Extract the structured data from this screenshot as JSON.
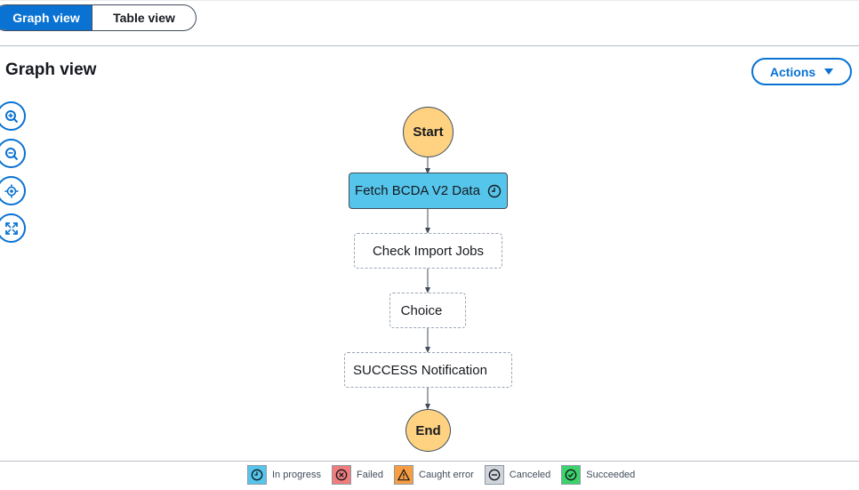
{
  "tabs": {
    "graph_view": "Graph view",
    "table_view": "Table view"
  },
  "header": {
    "title": "Graph view",
    "actions_label": "Actions"
  },
  "zoom_controls": [
    "zoom-in-icon",
    "zoom-out-icon",
    "center-icon",
    "fit-icon"
  ],
  "graph": {
    "start": "Start",
    "states": [
      {
        "label": "Fetch BCDA V2 Data",
        "status": "in-progress"
      },
      {
        "label": "Check Import Jobs",
        "status": "not-started"
      },
      {
        "label": "Choice",
        "status": "not-started"
      },
      {
        "label": "SUCCESS Notification",
        "status": "not-started"
      }
    ],
    "end": "End"
  },
  "legend": [
    {
      "label": "In progress",
      "icon": "clock-icon",
      "color": "#56c5eb"
    },
    {
      "label": "Failed",
      "icon": "x-circle-icon",
      "color": "#f07c7c"
    },
    {
      "label": "Caught error",
      "icon": "warning-icon",
      "color": "#f89e41"
    },
    {
      "label": "Canceled",
      "icon": "minus-circle-icon",
      "color": "#d1d5db"
    },
    {
      "label": "Succeeded",
      "icon": "check-circle-icon",
      "color": "#3ad46b"
    }
  ],
  "colors": {
    "accent": "#0972d3",
    "start_end": "#fed281",
    "in_progress": "#56c5eb"
  }
}
